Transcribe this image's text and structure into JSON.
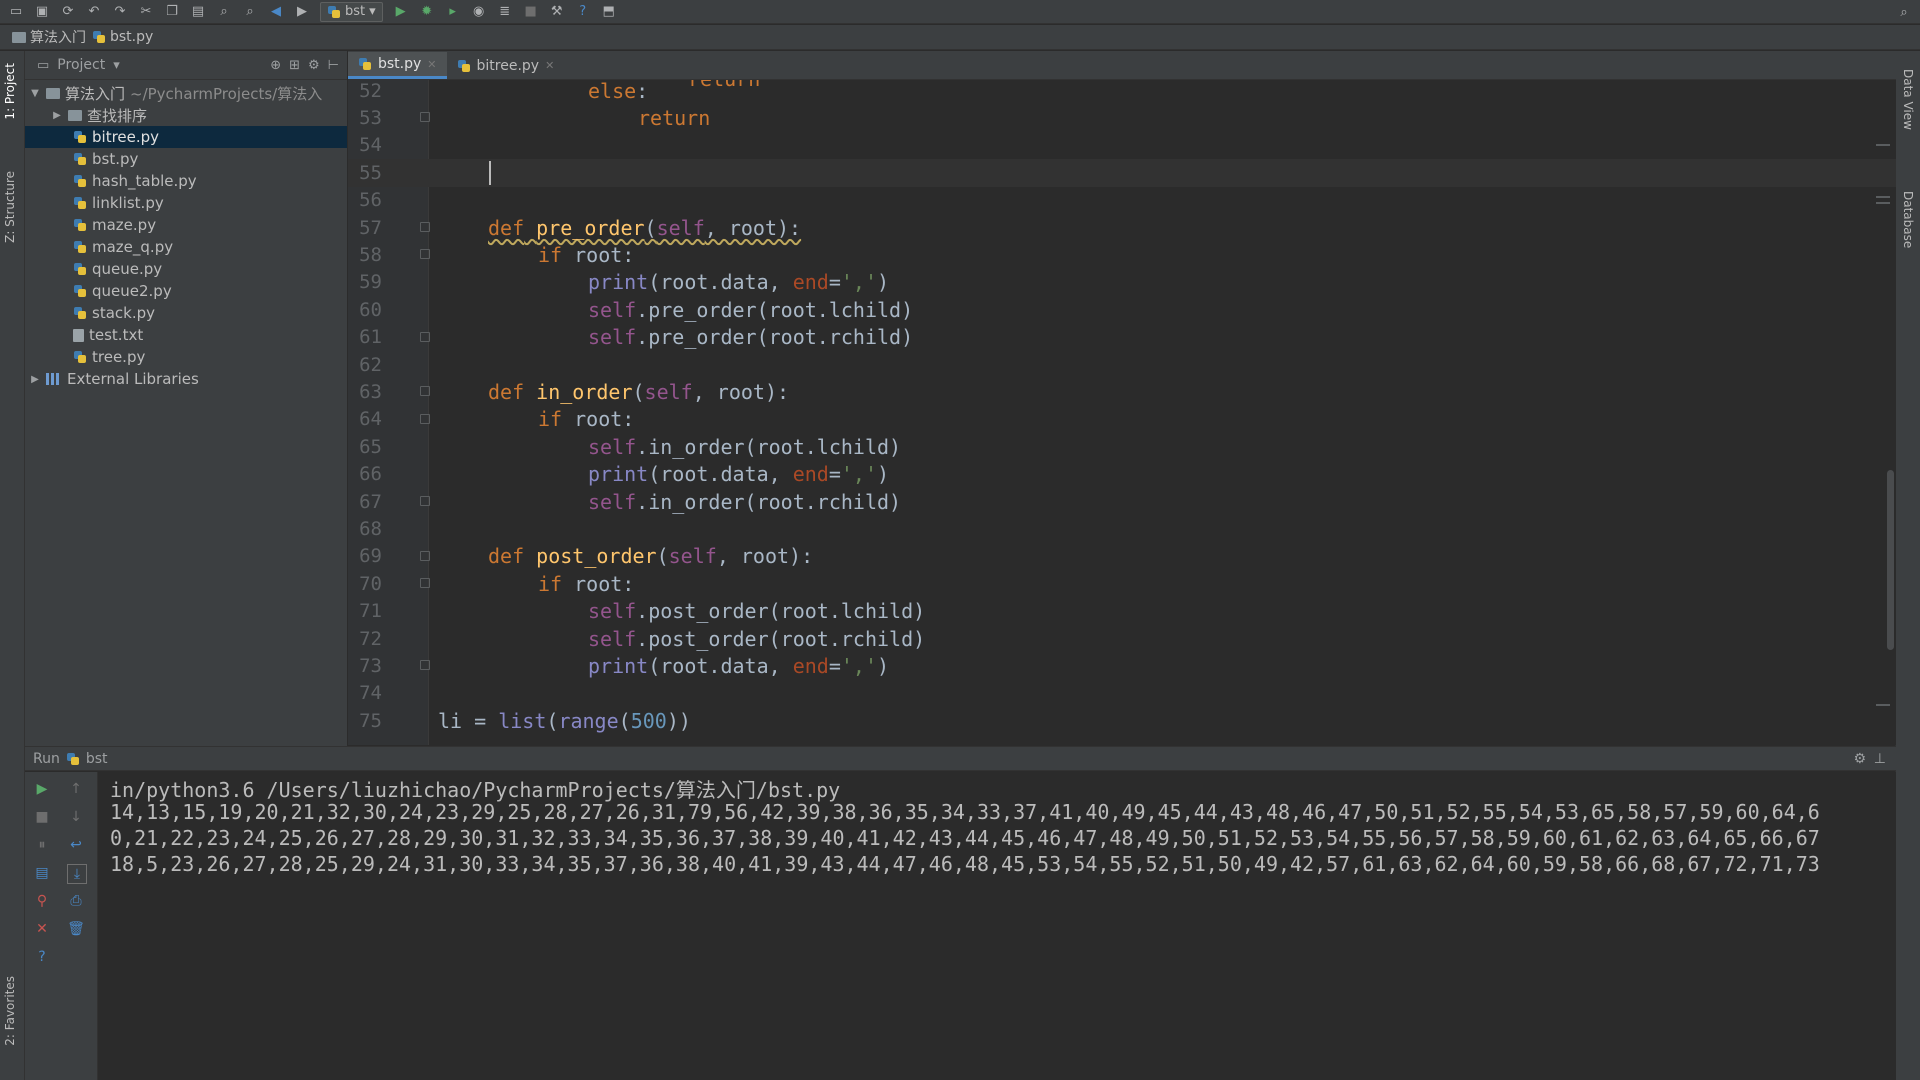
{
  "toolbar": {
    "run_config": "bst",
    "icons": [
      "open-icon",
      "save-icon",
      "sync-icon",
      "undo-icon",
      "redo-icon",
      "cut-icon",
      "copy-icon",
      "paste-icon",
      "find-icon",
      "replace-icon",
      "back-icon",
      "forward-icon",
      "run-icon",
      "debug-icon",
      "coverage-icon",
      "profile-icon",
      "concurrency-icon",
      "stop-icon",
      "settings-icon",
      "help-icon",
      "vcs-icon",
      "search-icon"
    ]
  },
  "navbar": {
    "project": "算法入门",
    "file": "bst.py"
  },
  "left_strip": {
    "project_tab": "1: Project",
    "structure_tab": "Z: Structure",
    "favorites_tab": "2: Favorites"
  },
  "right_strip": {
    "data_view_tab": "Data View",
    "database_tab": "Database"
  },
  "project_panel": {
    "header_label": "Project",
    "root_name": "算法入门",
    "root_path": "~/PycharmProjects/算法入",
    "folder": "查找排序",
    "files": [
      "bitree.py",
      "bst.py",
      "hash_table.py",
      "linklist.py",
      "maze.py",
      "maze_q.py",
      "queue.py",
      "queue2.py",
      "stack.py",
      "test.txt",
      "tree.py"
    ],
    "selected": "bitree.py",
    "external": "External Libraries"
  },
  "editor_tabs": [
    "bst.py",
    "bitree.py"
  ],
  "editor": {
    "line_numbers": [
      "52",
      "53",
      "54",
      "55",
      "56",
      "57",
      "58",
      "59",
      "60",
      "61",
      "62",
      "63",
      "64",
      "65",
      "66",
      "67",
      "68",
      "69",
      "70",
      "71",
      "72",
      "73",
      "74",
      "75"
    ],
    "partial_top": "return"
  },
  "run": {
    "header_label": "Run",
    "config_name": "bst",
    "console": [
      "in/python3.6 /Users/liuzhichao/PycharmProjects/算法入门/bst.py",
      "14,13,15,19,20,21,32,30,24,23,29,25,28,27,26,31,79,56,42,39,38,36,35,34,33,37,41,40,49,45,44,43,48,46,47,50,51,52,55,54,53,65,58,57,59,60,64,6",
      "0,21,22,23,24,25,26,27,28,29,30,31,32,33,34,35,36,37,38,39,40,41,42,43,44,45,46,47,48,49,50,51,52,53,54,55,56,57,58,59,60,61,62,63,64,65,66,67",
      "18,5,23,26,27,28,25,29,24,31,30,33,34,35,37,36,38,40,41,39,43,44,47,46,48,45,53,54,55,52,51,50,49,42,57,61,63,62,64,60,59,58,66,68,67,72,71,73"
    ]
  },
  "colors": {
    "keyword": "#cc7832",
    "function": "#ffc66d",
    "self": "#94558d",
    "builtin": "#8888c6",
    "string": "#6a8759",
    "number": "#6897bb",
    "param": "#aa4926",
    "selection": "#0d293e",
    "accent": "#4a88c7"
  }
}
